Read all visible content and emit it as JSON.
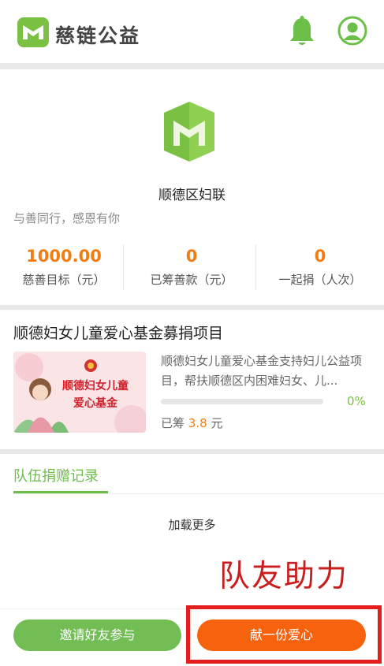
{
  "header": {
    "brand": "慈链公益",
    "bell_icon": "bell-icon",
    "user_icon": "user-icon"
  },
  "org": {
    "name": "顺德区妇联",
    "slogan": "与善同行，感恩有你"
  },
  "stats": [
    {
      "value": "1000.00",
      "label": "慈善目标（元）"
    },
    {
      "value": "0",
      "label": "已筹善款（元）"
    },
    {
      "value": "0",
      "label": "一起捐（人次）"
    }
  ],
  "project": {
    "title": "顺德妇女儿童爱心基金募捐项目",
    "image_text_line1": "顺德妇女儿童",
    "image_text_line2": "爱心基金",
    "description": "顺德妇女儿童爱心基金支持妇儿公益项目，帮扶顺德区内困难妇女、儿...",
    "progress_fraction": 0.0,
    "progress_text": "0%",
    "raised_prefix": "已筹",
    "raised_amount": "3.8",
    "raised_unit": "元"
  },
  "tabs": {
    "active": "队伍捐赠记录"
  },
  "load_more": "加载更多",
  "annotation": "队友助力",
  "footer": {
    "invite_label": "邀请好友参与",
    "donate_label": "献一份爱心"
  },
  "colors": {
    "accent_green": "#6cc04a",
    "accent_orange": "#f07d14",
    "donate_button": "#f7620e",
    "highlight_red": "#e41e1e"
  }
}
